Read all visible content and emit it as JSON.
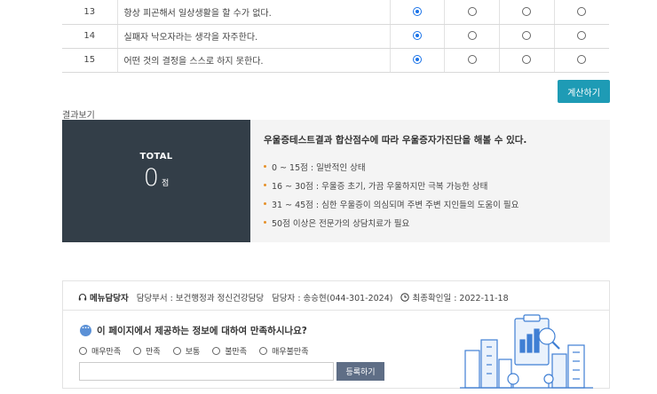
{
  "questions": [
    {
      "num": "13",
      "text": "항상 피곤해서 일상생활을 할 수가 없다.",
      "selected": 0
    },
    {
      "num": "14",
      "text": "실패자 낙오자라는 생각을 자주한다.",
      "selected": 0
    },
    {
      "num": "15",
      "text": "어떤 것의 결정을 스스로 하지 못한다.",
      "selected": 0
    }
  ],
  "calc_button": "계산하기",
  "results": {
    "title": "결과보기",
    "total_label": "TOTAL",
    "score": "0",
    "score_unit": "점",
    "desc_title": "우울증테스트결과 합산점수에 따라 우울증자가진단을 해볼 수 있다.",
    "ranges": [
      "0 ~ 15점 : 일반적인 상태",
      "16 ~ 30점 : 우울증 초기, 가끔 우울하지만 극복 가능한 상태",
      "31 ~ 45점 : 심한 우울증이 의심되며 주변 주변 지인들의 도움이 필요",
      "50점 이상은 전문가의 상담치료가 필요"
    ]
  },
  "manager": {
    "label": "메뉴담당자",
    "department": "담당부서 : 보건행정과 정신건강담당",
    "person": "담당자 : 송승현(044-301-2024)",
    "last_checked": "최종확인일 : 2022-11-18"
  },
  "survey": {
    "question": "이 페이지에서 제공하는 정보에 대하여 만족하시나요?",
    "options": [
      "매우만족",
      "만족",
      "보통",
      "불만족",
      "매우불만족"
    ],
    "input_placeholder": "",
    "submit": "등록하기"
  },
  "colors": {
    "accent": "#1e9bb5",
    "total_panel": "#333e48",
    "bullet": "#e6912a",
    "radio_checked": "#1a73e8",
    "submit": "#5f6e86"
  }
}
